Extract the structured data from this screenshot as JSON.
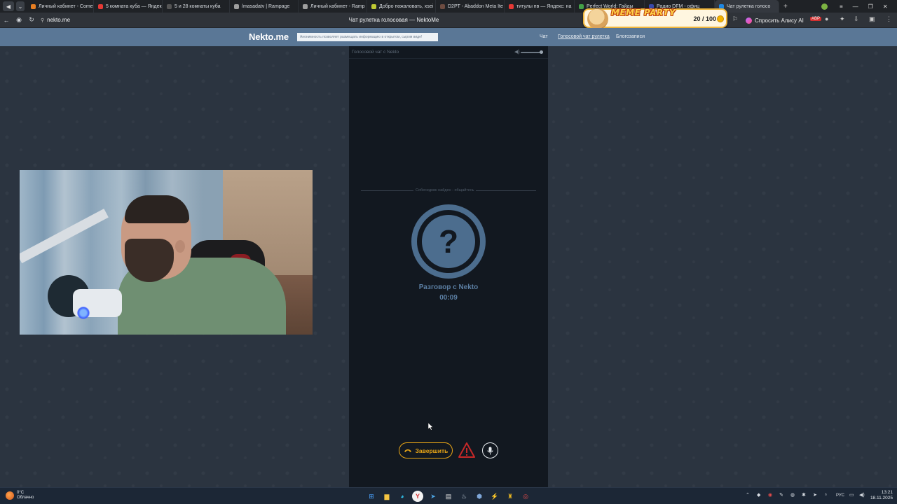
{
  "browser": {
    "tabs": [
      {
        "label": "Личный кабинет - Comet",
        "color": "#e67e22"
      },
      {
        "label": "5 комната куба — Яндекс",
        "color": "#e53935"
      },
      {
        "label": "5 и 28 комнаты куба",
        "color": "#555555"
      },
      {
        "label": "/masadatv | Rampage",
        "color": "#9e9e9e"
      },
      {
        "label": "Личный кабинет - Ramp",
        "color": "#9e9e9e"
      },
      {
        "label": "Добро пожаловать, xsei",
        "color": "#c0ca33"
      },
      {
        "label": "D2PT - Abaddon Meta Ite",
        "color": "#6d4c41"
      },
      {
        "label": "титулы пв — Яндекс: на",
        "color": "#e53935"
      },
      {
        "label": "Perfect World: Гайды",
        "color": "#43a047"
      },
      {
        "label": "Радио DFM - офиц",
        "color": "#3949ab"
      },
      {
        "label": "Чат рулетка голосо",
        "color": "#1e88e5"
      }
    ],
    "new_tab_glyph": "+",
    "url": "nekto.me",
    "page_title": "Чат рулетка голосовая — NektoMe",
    "alisa_label": "Спросить Алису AI",
    "window_controls": [
      "≡",
      "—",
      "❐",
      "✕"
    ]
  },
  "meme_widget": {
    "title": "MEME PARTY",
    "count": "20 / 100"
  },
  "site": {
    "logo": "Nekto.me",
    "notice": "Анонимность позволяет размещать информацию в открытом, сыром виде!",
    "nav": [
      "Чат",
      "Голосовой чат рулетка",
      "Блогозаписи"
    ]
  },
  "panel": {
    "header_title": "Голосовой чат с Nekto",
    "volume_level": 0.9,
    "status_divider": "Собеседник найден - общайтесь",
    "avatar_glyph": "?",
    "conversation_label": "Разговор с Nekto",
    "timer": "00:09",
    "end_button_label": "Завершить"
  },
  "taskbar": {
    "weather_temp": "0°C",
    "weather_desc": "Облачно",
    "language": "РУС",
    "time": "13:21",
    "date": "18.11.2025"
  },
  "colors": {
    "accent_blue": "#4c6d8e",
    "end_button": "#e8a516",
    "warning": "#c62828",
    "site_header": "#5a7796",
    "panel_bg": "#121820"
  }
}
